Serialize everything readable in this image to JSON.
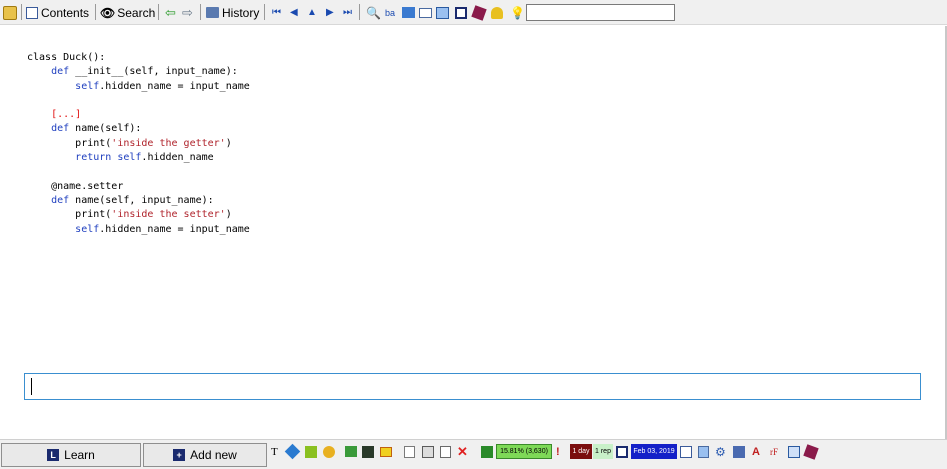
{
  "toolbar": {
    "contents_label": "Contents",
    "search_label": "Search",
    "history_label": "History",
    "search_value": ""
  },
  "code": {
    "line1": "class Duck():",
    "line2_kw": "def",
    "line2_rest": " __init__(self, input_name):",
    "line3_kw": "self",
    "line3_rest": ".hidden_name = input_name",
    "line4": "[...]",
    "line5_kw": "def",
    "line5_rest": " name(self):",
    "line6_a": "print(",
    "line6_str": "'inside the getter'",
    "line6_b": ")",
    "line7_kw": "return",
    "line7_mid": " ",
    "line7_kw2": "self",
    "line7_rest": ".hidden_name",
    "line8": "@name.setter",
    "line9_kw": "def",
    "line9_rest": " name(self, input_name):",
    "line10_a": "print(",
    "line10_str": "'inside the setter'",
    "line10_b": ")",
    "line11_kw": "self",
    "line11_rest": ".hidden_name = input_name"
  },
  "answer": {
    "value": ""
  },
  "bottom": {
    "learn_label": "Learn",
    "add_new_label": "Add new",
    "stats_label": "15.81% (3,630)",
    "interval_label": "1 day",
    "reps_label": "1 rep",
    "date_label": "Feb 03, 2019"
  },
  "colors": {
    "accent_blue": "#1f3fbf",
    "string_red": "#b0242c",
    "cloze_red": "#e01010",
    "answer_border": "#3a8fd0",
    "stats_green": "#7ed957",
    "interval_bg": "#7a0d0d",
    "reps_bg": "#c8f0c8",
    "date_bg": "#1420c8"
  }
}
